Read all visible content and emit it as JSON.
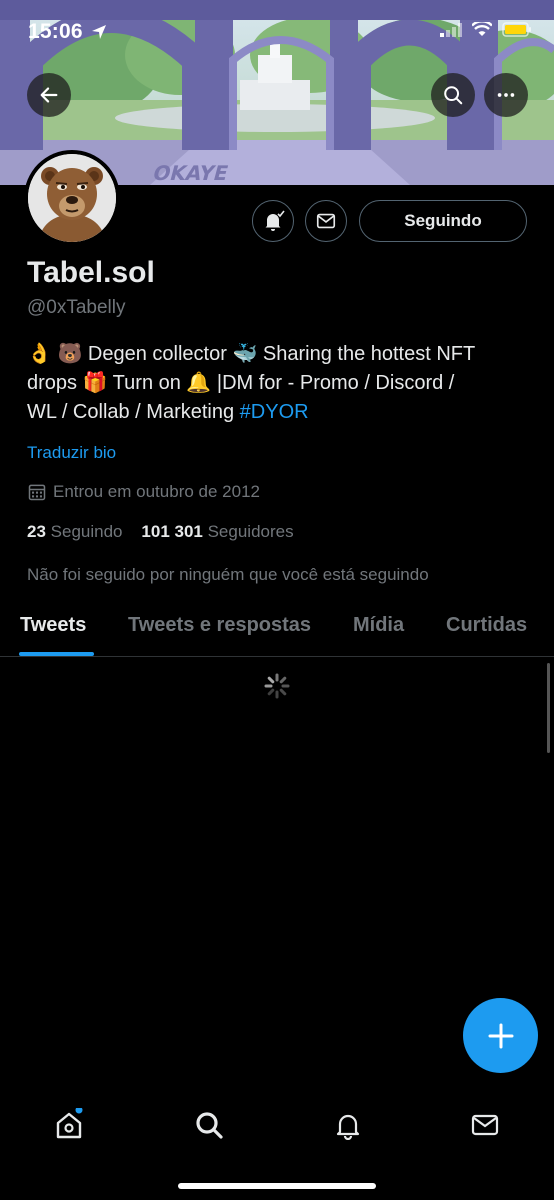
{
  "status_bar": {
    "time": "15:06"
  },
  "profile": {
    "display_name": "Tabel.sol",
    "handle": "@0xTabelly",
    "bio_line1": "👌 🐻 Degen collector 🐳 Sharing the hottest NFT",
    "bio_line2": "drops 🎁 Turn on 🔔 |DM for - Promo / Discord /",
    "bio_line3_prefix": "WL / Collab / Marketing ",
    "bio_hashtag": "#DYOR",
    "translate_label": "Traduzir bio",
    "joined": "Entrou em outubro de 2012",
    "following_count": "23",
    "following_label": "Seguindo",
    "followers_count": "101 301",
    "followers_label": "Seguidores",
    "followed_by_note": "Não foi seguido por ninguém que você está seguindo"
  },
  "actions": {
    "following_button": "Seguindo"
  },
  "tabs": [
    {
      "label": "Tweets",
      "active": true
    },
    {
      "label": "Tweets e respostas",
      "active": false
    },
    {
      "label": "Mídia",
      "active": false
    },
    {
      "label": "Curtidas",
      "active": false
    }
  ],
  "icons": {
    "back": "arrow-left-icon",
    "search": "search-icon",
    "more": "more-icon",
    "notify": "bell-check-icon",
    "message": "mail-icon",
    "calendar": "calendar-icon",
    "compose": "plus-icon",
    "home": "home-icon",
    "explore": "search-icon",
    "notifications": "bell-icon",
    "messages": "mail-icon"
  },
  "colors": {
    "accent": "#1d9bf0",
    "background": "#000000",
    "muted": "#71767b"
  }
}
